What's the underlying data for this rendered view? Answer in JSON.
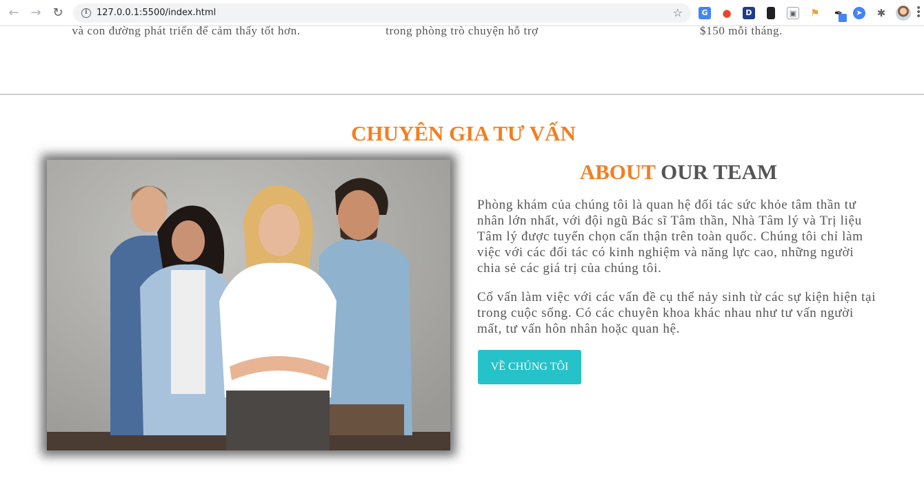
{
  "browser": {
    "url": "127.0.0.1:5500/index.html",
    "icons": [
      "back-arrow-icon",
      "forward-arrow-icon",
      "reload-icon",
      "info-icon",
      "star-icon",
      "translate-extension-icon",
      "fire-extension-icon",
      "d-extension-icon",
      "book-extension-icon",
      "language-extension-icon",
      "bookmark-extension-icon",
      "eyedropper-extension-icon",
      "compass-extension-icon",
      "puzzle-extension-icon",
      "profile-avatar",
      "menu-dots-icon"
    ]
  },
  "previous_section": {
    "item1": "và con đường phát triển để cảm thấy tốt hơn.",
    "item2": "trong phòng trò chuyện hỗ trợ",
    "item3": "$150 mỗi tháng."
  },
  "section": {
    "title": "CHUYÊN GIA TƯ VẤN"
  },
  "about": {
    "heading_accent": "ABOUT",
    "heading_rest": "OUR TEAM",
    "paragraph1": "Phòng khám của chúng tôi là quan hệ đối tác sức khỏe tâm thần tư nhân lớn nhất, với đội ngũ Bác sĩ Tâm thần, Nhà Tâm lý và Trị liệu Tâm lý được tuyển chọn cẩn thận trên toàn quốc. Chúng tôi chỉ làm việc với các đối tác có kinh nghiệm và năng lực cao, những người chia sẻ các giá trị của chúng tôi.",
    "paragraph2": "Cố vấn làm việc với các vấn đề cụ thể nảy sinh từ các sự kiện hiện tại trong cuộc sống. Có các chuyên khoa khác nhau như tư vấn người mất, tư vấn hôn nhân hoặc quan hệ.",
    "button_label": "VỀ CHÚNG TÔI"
  },
  "colors": {
    "accent_orange": "#f47e20",
    "button_teal": "#26c2c9",
    "text_gray": "#555555"
  }
}
